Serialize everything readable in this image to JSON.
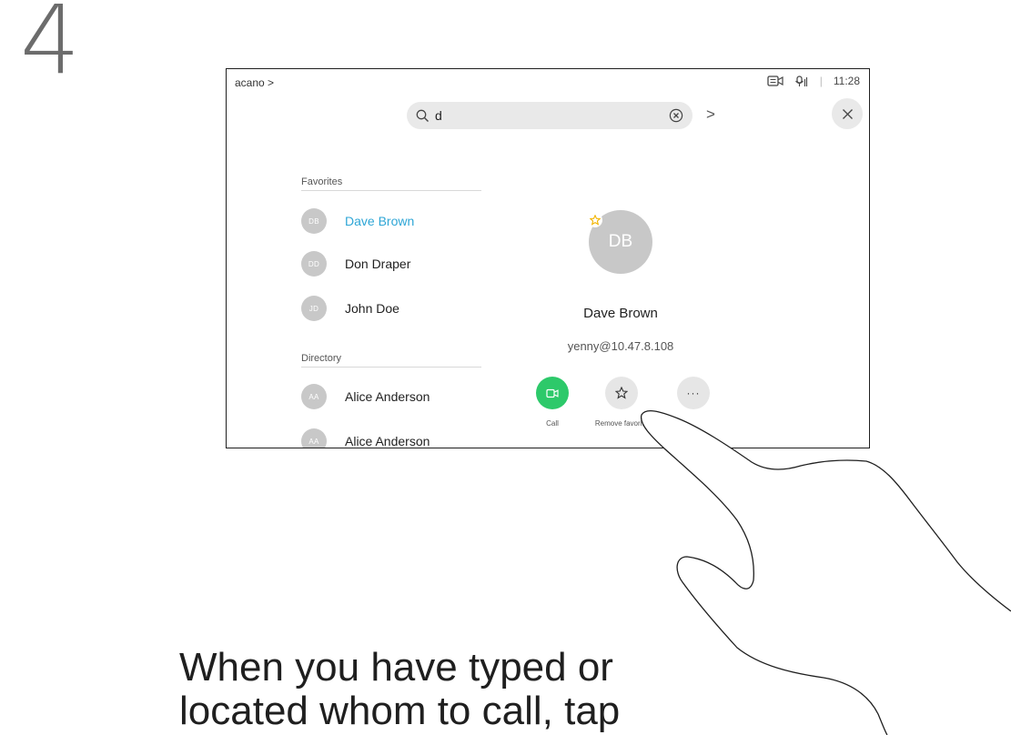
{
  "step_number": "4",
  "header": {
    "breadcrumb": "acano >",
    "time": "11:28",
    "separator": "|",
    "icons": [
      "camera-icon",
      "microphone-icon"
    ]
  },
  "search": {
    "value": "d",
    "next_arrow": ">",
    "close_icon": "×"
  },
  "favorites": {
    "header": "Favorites",
    "contacts": [
      {
        "initials": "DB",
        "name": "Dave Brown"
      },
      {
        "initials": "DD",
        "name": "Don Draper"
      },
      {
        "initials": "JD",
        "name": "John Doe"
      }
    ]
  },
  "directory": {
    "header": "Directory",
    "contacts": [
      {
        "initials": "AA",
        "name": "Alice Anderson"
      },
      {
        "initials": "AA",
        "name": "Alice Anderson"
      }
    ]
  },
  "detail": {
    "initials": "DB",
    "name": "Dave Brown",
    "address": "yenny@10.47.8.108",
    "favorite_star": "☆",
    "actions": {
      "call_label": "Call",
      "remove_favorite_label": "Remove favorite",
      "remove_favorite_star": "☆",
      "more": "···"
    }
  },
  "instruction": {
    "line1": "When you have typed or",
    "line2": "located whom to call, tap"
  },
  "colors": {
    "call_green": "#2dc96a",
    "highlight_blue": "#2ea6d6",
    "avatar_gray": "#c8c8c8",
    "favorite_yellow": "#f2b400"
  }
}
